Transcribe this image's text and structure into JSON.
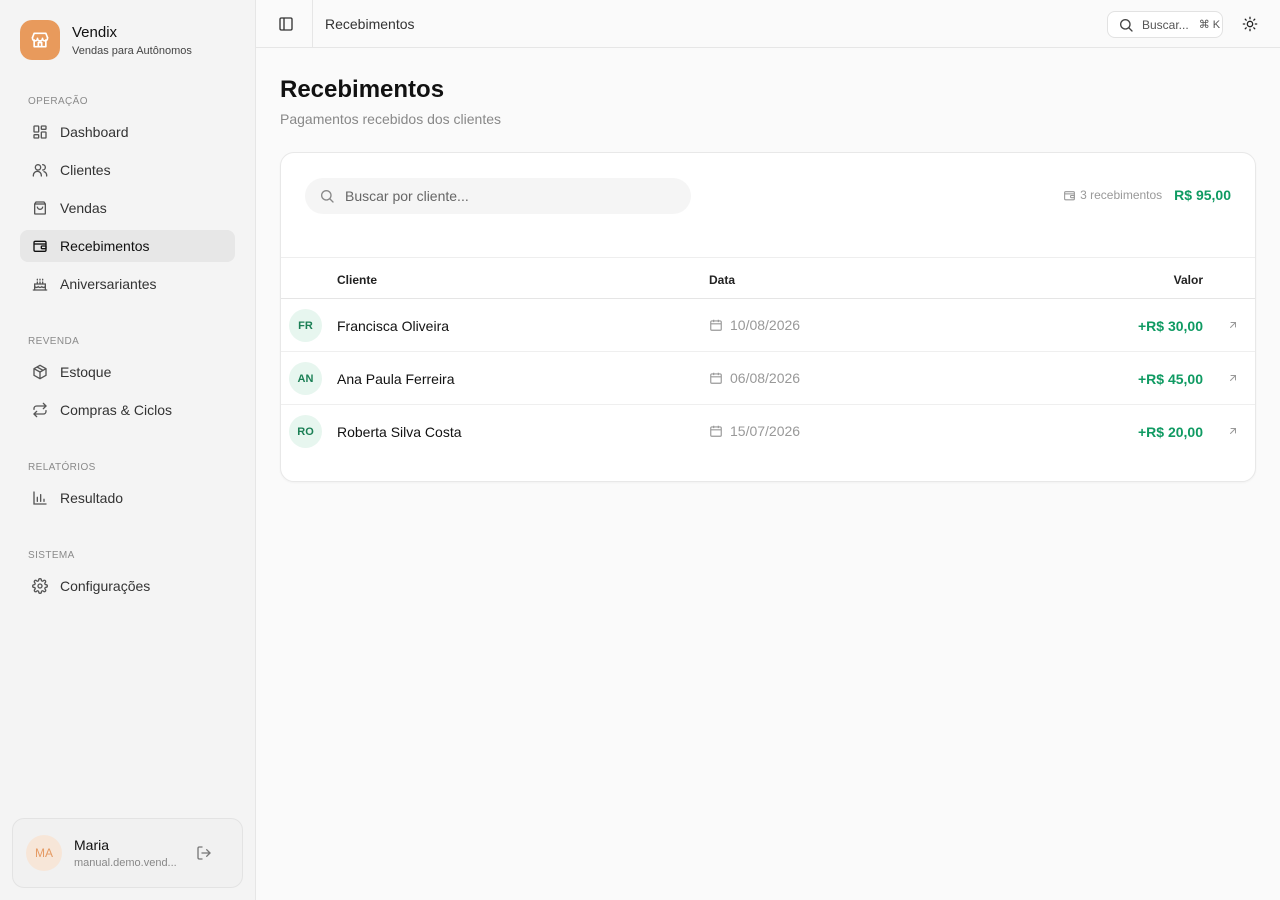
{
  "brand": {
    "name": "Vendix",
    "tagline": "Vendas para Autônomos"
  },
  "nav": {
    "sections": [
      {
        "heading": "OPERAÇÃO",
        "items": [
          {
            "label": "Dashboard",
            "icon": "dashboard-icon"
          },
          {
            "label": "Clientes",
            "icon": "users-icon"
          },
          {
            "label": "Vendas",
            "icon": "shopping-bag-icon"
          },
          {
            "label": "Recebimentos",
            "icon": "wallet-icon",
            "active": true
          },
          {
            "label": "Aniversariantes",
            "icon": "cake-icon"
          }
        ]
      },
      {
        "heading": "REVENDA",
        "items": [
          {
            "label": "Estoque",
            "icon": "package-icon"
          },
          {
            "label": "Compras & Ciclos",
            "icon": "repeat-icon"
          }
        ]
      },
      {
        "heading": "RELATÓRIOS",
        "items": [
          {
            "label": "Resultado",
            "icon": "bar-chart-icon"
          }
        ]
      },
      {
        "heading": "SISTEMA",
        "items": [
          {
            "label": "Configurações",
            "icon": "gear-icon"
          }
        ]
      }
    ]
  },
  "user": {
    "initials": "MA",
    "name": "Maria",
    "email": "manual.demo.vend..."
  },
  "topbar": {
    "title": "Recebimentos",
    "search_label": "Buscar...",
    "shortcut": "⌘ K"
  },
  "page": {
    "title": "Recebimentos",
    "subtitle": "Pagamentos recebidos dos clientes"
  },
  "filter": {
    "placeholder": "Buscar por cliente..."
  },
  "summary": {
    "count_label": "3 recebimentos",
    "total": "R$ 95,00"
  },
  "table": {
    "columns": {
      "client": "Cliente",
      "date": "Data",
      "value": "Valor"
    },
    "rows": [
      {
        "initials": "FR",
        "client": "Francisca Oliveira",
        "date": "10/08/2026",
        "value": "+R$ 30,00"
      },
      {
        "initials": "AN",
        "client": "Ana Paula Ferreira",
        "date": "06/08/2026",
        "value": "+R$ 45,00"
      },
      {
        "initials": "RO",
        "client": "Roberta Silva Costa",
        "date": "15/07/2026",
        "value": "+R$ 20,00"
      }
    ]
  },
  "colors": {
    "accent": "#e89a5c",
    "positive": "#0f9a62",
    "avatar_bg": "#e7f6ef"
  }
}
